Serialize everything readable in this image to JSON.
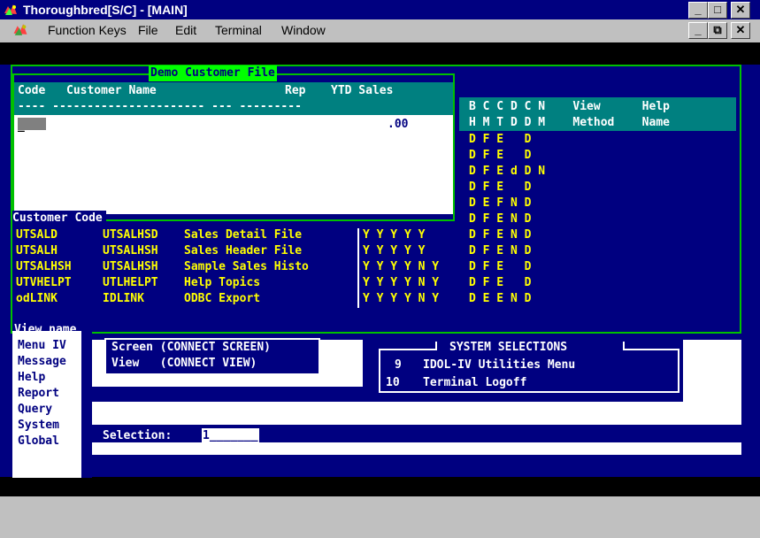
{
  "window": {
    "title": "Thoroughbred[S/C] - [MAIN]",
    "controls": {
      "minimize": "_",
      "maximize": "□",
      "close": "✕",
      "restore": "⧉"
    }
  },
  "menu": {
    "items": [
      "Function Keys",
      "File",
      "Edit",
      "Terminal",
      "Window"
    ],
    "mnemonics": [
      "",
      "F",
      "E",
      "T",
      "W"
    ]
  },
  "customer_file": {
    "title": "Demo Customer File",
    "headers": {
      "code": "Code",
      "customer_name": "Customer Name",
      "rep": "Rep",
      "ytd_sales": "YTD Sales"
    },
    "dashes": "---- ---------------------- --- ---------",
    "cursor": "_",
    "ytd_value": ".00",
    "footer_label": "Customer Code"
  },
  "views_table": {
    "header_row1": "B C C D C N    View      Help",
    "header_row2": "H M T D D M    Method    Name",
    "rows": [
      {
        "code": "",
        "link": "",
        "desc": "",
        "flags": "",
        "right": "D F E   D"
      },
      {
        "code": "",
        "link": "",
        "desc": "",
        "flags": "",
        "right": "D F E   D"
      },
      {
        "code": "",
        "link": "",
        "desc": "",
        "flags": "",
        "right": "D F E d D N"
      },
      {
        "code": "",
        "link": "",
        "desc": "",
        "flags": "",
        "right": "D F E   D"
      },
      {
        "code": "",
        "link": "",
        "desc": "",
        "flags": "",
        "right": "D E F N D"
      },
      {
        "code": "",
        "link": "",
        "desc": "",
        "flags": "",
        "right": "D F E N D"
      },
      {
        "code": "UTSALD",
        "link": "UTSALHSD",
        "desc": "Sales Detail File",
        "flags": "Y Y Y Y Y  ",
        "right": "D F E N D"
      },
      {
        "code": "UTSALH",
        "link": "UTSALHSH",
        "desc": "Sales Header File",
        "flags": "Y Y Y Y Y  ",
        "right": "D F E N D"
      },
      {
        "code": "UTSALHSH",
        "link": "UTSALHSH",
        "desc": "Sample Sales Histo",
        "flags": "Y Y Y Y N Y",
        "right": "D F E   D"
      },
      {
        "code": "UTVHELPT",
        "link": "UTLHELPT",
        "desc": "Help Topics",
        "flags": "Y Y Y Y N Y",
        "right": "D F E   D"
      },
      {
        "code": "odLINK",
        "link": "IDLINK",
        "desc": "ODBC Export",
        "flags": "Y Y Y Y N Y",
        "right": "D E E N D"
      }
    ],
    "footer_label": "View name"
  },
  "side_menu": {
    "items": [
      "Menu IV",
      "Message",
      "Help",
      "Report",
      "Query",
      "System",
      "Global"
    ]
  },
  "connect_box": {
    "lines": [
      "Screen (CONNECT SCREEN)",
      "View   (CONNECT VIEW)"
    ]
  },
  "system_selections": {
    "title": "SYSTEM SELECTIONS",
    "items": [
      {
        "num": "9",
        "label": "IDOL-IV Utilities Menu"
      },
      {
        "num": "10",
        "label": "Terminal Logoff"
      }
    ]
  },
  "selection": {
    "label": "Selection:",
    "value": "1_______"
  },
  "colors": {
    "terminal_bg": "#000080",
    "header_teal": "#008080",
    "border_green": "#00c000",
    "text_yellow": "#ffff00",
    "text_white": "#ffffff"
  }
}
